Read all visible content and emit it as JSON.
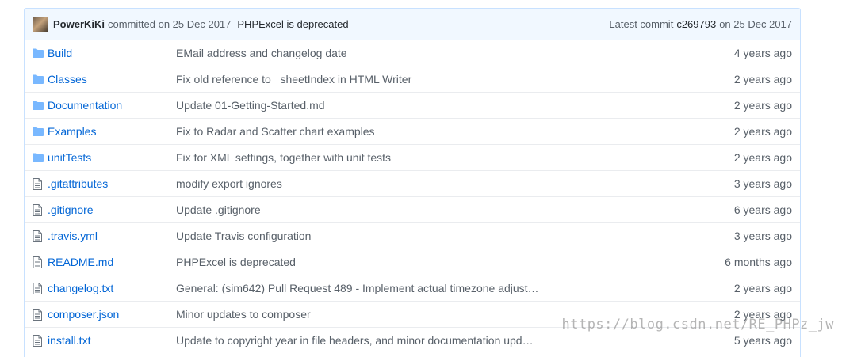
{
  "latest_commit": {
    "author": "PowerKiKi",
    "verb": "committed on 25 Dec 2017",
    "message": "PHPExcel is deprecated",
    "latest_label": "Latest commit",
    "sha": "c269793",
    "date": "on 25 Dec 2017"
  },
  "files": [
    {
      "type": "folder",
      "name": "Build",
      "message": "EMail address and changelog date",
      "age": "4 years ago"
    },
    {
      "type": "folder",
      "name": "Classes",
      "message": "Fix old reference to _sheetIndex in HTML Writer",
      "age": "2 years ago"
    },
    {
      "type": "folder",
      "name": "Documentation",
      "message": "Update 01-Getting-Started.md",
      "age": "2 years ago"
    },
    {
      "type": "folder",
      "name": "Examples",
      "message": "Fix to Radar and Scatter chart examples",
      "age": "2 years ago"
    },
    {
      "type": "folder",
      "name": "unitTests",
      "message": "Fix for XML settings, together with unit tests",
      "age": "2 years ago"
    },
    {
      "type": "file",
      "name": ".gitattributes",
      "message": "modify export ignores",
      "age": "3 years ago"
    },
    {
      "type": "file",
      "name": ".gitignore",
      "message": "Update .gitignore",
      "age": "6 years ago"
    },
    {
      "type": "file",
      "name": ".travis.yml",
      "message": "Update Travis configuration",
      "age": "3 years ago"
    },
    {
      "type": "file",
      "name": "README.md",
      "message": "PHPExcel is deprecated",
      "age": "6 months ago"
    },
    {
      "type": "file",
      "name": "changelog.txt",
      "message": "General: (sim642) Pull Request 489 - Implement actual timezone adjust…",
      "age": "2 years ago"
    },
    {
      "type": "file",
      "name": "composer.json",
      "message": "Minor updates to composer",
      "age": "2 years ago"
    },
    {
      "type": "file",
      "name": "install.txt",
      "message": "Update to copyright year in file headers, and minor documentation upd…",
      "age": "5 years ago"
    }
  ],
  "watermark": "https://blog.csdn.net/RE_PHPz_jw",
  "colors": {
    "link": "#0366d6",
    "folder_icon": "#79b8ff",
    "muted": "#586069",
    "commit_bg": "#f1f8ff"
  }
}
